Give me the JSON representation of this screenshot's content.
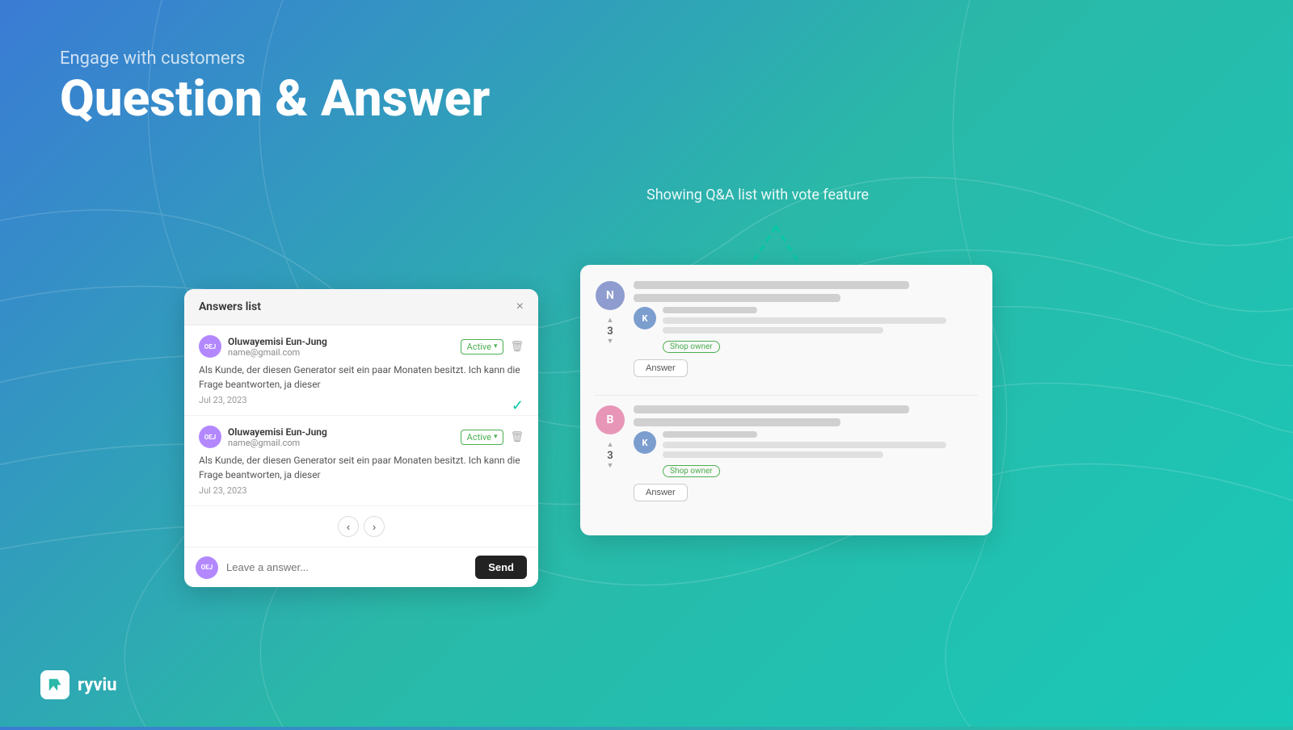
{
  "background": {
    "gradient_start": "#3a7bd5",
    "gradient_end": "#1ac8b8"
  },
  "header": {
    "engage_label": "Engage with customers",
    "main_title": "Question & Answer"
  },
  "annotation": {
    "text": "Showing Q&A list with\nvote feature"
  },
  "answers_modal": {
    "title": "Answers list",
    "close_label": "×",
    "items": [
      {
        "avatar_initials": "OEJ",
        "name": "Oluwayemisi Eun-Jung",
        "email": "name@gmail.com",
        "status": "Active",
        "text": "Als Kunde, der diesen Generator seit ein paar Monaten besitzt. Ich kann die Frage beantworten, ja dieser",
        "date": "Jul 23, 2023"
      },
      {
        "avatar_initials": "OEJ",
        "name": "Oluwayemisi Eun-Jung",
        "email": "name@gmail.com",
        "status": "Active",
        "text": "Als Kunde, der diesen Generator seit ein paar Monaten besitzt. Ich kann die Frage beantworten, ja dieser",
        "date": "Jul 23, 2023"
      }
    ],
    "compose_placeholder": "Leave a answer...",
    "send_label": "Send"
  },
  "qa_panel": {
    "items": [
      {
        "avatar_letter": "N",
        "avatar_class": "avatar-n",
        "vote_count": "3",
        "answer_avatar": "K",
        "shop_owner_label": "Shop owner",
        "answer_button_label": "Answer"
      },
      {
        "avatar_letter": "B",
        "avatar_class": "avatar-b",
        "vote_count": "3",
        "answer_avatar": "K",
        "shop_owner_label": "Shop owner",
        "answer_button_label": "Answer"
      }
    ]
  },
  "logo": {
    "text": "ryviu"
  }
}
